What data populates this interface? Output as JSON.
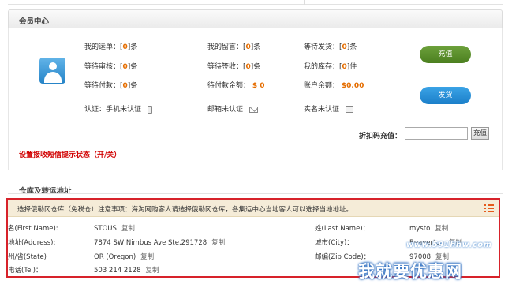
{
  "member": {
    "title": "会员中心",
    "stats": {
      "waybill": {
        "label": "我的运单：",
        "lb": "[",
        "value": "0",
        "rb": "]",
        "unit": "条"
      },
      "review": {
        "label": "等待审核：",
        "lb": "[",
        "value": "0",
        "rb": "]",
        "unit": "条"
      },
      "payment": {
        "label": "等待付款：",
        "lb": "[",
        "value": "0",
        "rb": "]",
        "unit": "条"
      },
      "message": {
        "label": "我的留言：",
        "lb": "[",
        "value": "0",
        "rb": "]",
        "unit": "条"
      },
      "signing": {
        "label": "等待签收：",
        "lb": "[",
        "value": "0",
        "rb": "]",
        "unit": "条"
      },
      "pending_amount": {
        "label": "待付款金额：",
        "value": "$ 0"
      },
      "ship_wait": {
        "label": "等待发货：",
        "lb": "[",
        "value": "0",
        "rb": "]",
        "unit": "条"
      },
      "inventory": {
        "label": "我的库存：",
        "lb": "[",
        "value": "0",
        "rb": "]",
        "unit": "件"
      },
      "balance": {
        "label": "账户余额：",
        "value": "$0.00"
      }
    },
    "verify": {
      "phone": "认证：手机未认证",
      "email": "邮箱未认证",
      "realname": "实名未认证"
    },
    "buttons": {
      "recharge": "充值",
      "ship": "发货"
    },
    "promo": {
      "label": "折扣码充值：",
      "button": "充值"
    },
    "sms_link": "设置接收短信提示状态（开/关）"
  },
  "warehouse": {
    "section_title": "仓库及转运地址",
    "notice": "选择俄勒冈仓库（免税仓）注意事项：海淘网购客人请选择俄勒冈仓库，各集运中心当地客人可以选择当地地址。",
    "copy_label": "复制",
    "fields": {
      "first_name": {
        "label": "名(First Name):",
        "value": "STOUS"
      },
      "last_name": {
        "label": "姓(Last Name)：",
        "value": "mysto"
      },
      "address": {
        "label": "地址(Address):",
        "value": "7874 SW Nimbus Ave Ste.291728"
      },
      "city": {
        "label": "城市(City)：",
        "value": "Beaverton"
      },
      "state": {
        "label": "州/省(State)",
        "value": "OR (Oregon)"
      },
      "zip": {
        "label": "邮编(Zip Code)：",
        "value": "97008"
      },
      "tel": {
        "label": "电话(Tel)：",
        "value": "503 214 2128"
      }
    }
  },
  "watermark": {
    "url": "www.591hhw.com",
    "text": "我就要优惠网"
  },
  "colors": {
    "accent_orange": "#e56d00",
    "alert_red": "#d10000",
    "border_red": "#d7222a",
    "button_green": "#5a8f2b",
    "button_blue": "#2a8fd6"
  }
}
